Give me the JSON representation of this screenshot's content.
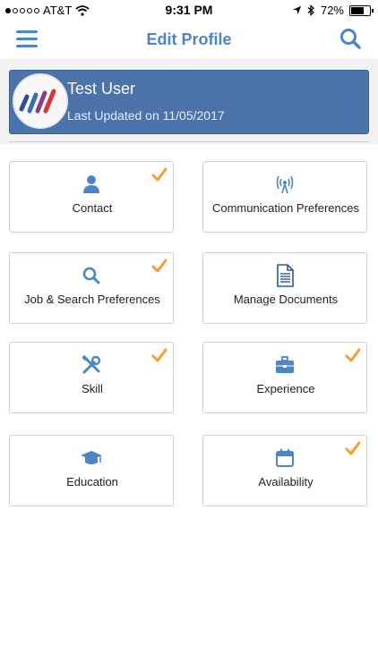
{
  "status": {
    "carrier": "AT&T",
    "time": "9:31 PM",
    "battery_percent": "72%",
    "battery_level": 0.72
  },
  "header": {
    "title": "Edit Profile",
    "menu_icon": "hamburger-menu-icon",
    "search_icon": "search-icon"
  },
  "profile": {
    "name": "Test  User",
    "updated": "Last Updated on  11/05/2017"
  },
  "cards": {
    "contact": {
      "label": "Contact",
      "icon": "person-icon",
      "checked": true
    },
    "communication": {
      "label": "Communication Preferences",
      "icon": "antenna-icon",
      "checked": false
    },
    "job_search": {
      "label": "Job & Search Preferences",
      "icon": "search-icon",
      "checked": true
    },
    "documents": {
      "label": "Manage Documents",
      "icon": "document-icon",
      "checked": false
    },
    "skill": {
      "label": "Skill",
      "icon": "tools-icon",
      "checked": true
    },
    "experience": {
      "label": "Experience",
      "icon": "briefcase-icon",
      "checked": true
    },
    "education": {
      "label": "Education",
      "icon": "graduation-cap-icon",
      "checked": false
    },
    "availability": {
      "label": "Availability",
      "icon": "calendar-icon",
      "checked": true
    }
  },
  "colors": {
    "accent": "#4a86c5",
    "banner": "#4b73a9",
    "check": "#f0a030"
  }
}
